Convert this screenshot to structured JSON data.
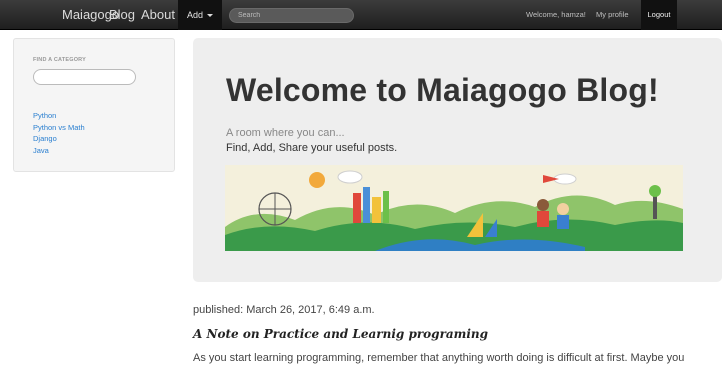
{
  "navbar": {
    "brand": "Maiagogo",
    "blog": "Blog",
    "about": "About",
    "add": "Add",
    "search_placeholder": "Search",
    "welcome": "Welcome, hamza!",
    "profile": "My profile",
    "logout": "Logout"
  },
  "sidebar": {
    "header": "FIND A CATEGORY",
    "categories": [
      "Python",
      "Python vs Math",
      "Django",
      "Java"
    ]
  },
  "hero": {
    "title": "Welcome to Maiagogo Blog!",
    "subtitle": "A room where you can...",
    "subtitle2": "Find, Add, Share your useful posts."
  },
  "post": {
    "published": "published: March 26, 2017, 6:49 a.m.",
    "title": "A Note on Practice and Learnig programing",
    "body": "As you start learning programming, remember that anything worth doing is difficult at first. Maybe you"
  },
  "colors": {
    "navbar": "#222222",
    "link": "#2a7fd0",
    "hero_bg": "#eeeeee"
  }
}
